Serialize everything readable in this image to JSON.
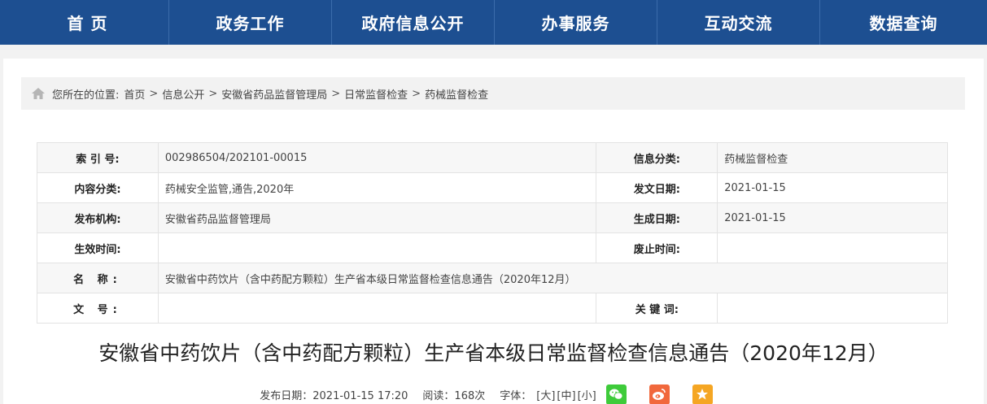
{
  "nav": {
    "items": [
      "首 页",
      "政务工作",
      "政府信息公开",
      "办事服务",
      "互动交流",
      "数据查询"
    ]
  },
  "breadcrumb": {
    "prefix": "您所在的位置:",
    "items": [
      "首页",
      "信息公开",
      "安徽省药品监督管理局",
      "日常监督检查",
      "药械监督检查"
    ],
    "separator": ">"
  },
  "meta": {
    "rows": [
      {
        "l1": "索 引 号:",
        "v1": "002986504/202101-00015",
        "l2": "信息分类:",
        "v2": "药械监督检查"
      },
      {
        "l1": "内容分类:",
        "v1": "药械安全监管,通告,2020年",
        "l2": "发文日期:",
        "v2": "2021-01-15"
      },
      {
        "l1": "发布机构:",
        "v1": "安徽省药品监督管理局",
        "l2": "生成日期:",
        "v2": "2021-01-15"
      },
      {
        "l1": "生效时间:",
        "v1": "",
        "l2": "废止时间:",
        "v2": ""
      },
      {
        "l1": "名 称:",
        "v1": "安徽省中药饮片（含中药配方颗粒）生产省本级日常监督检查信息通告（2020年12月）"
      },
      {
        "l1": "文 号:",
        "v1": "",
        "l2": "关 键 词:",
        "v2": ""
      }
    ]
  },
  "article": {
    "title": "安徽省中药饮片（含中药配方颗粒）生产省本级日常监督检查信息通告（2020年12月）",
    "publish": "发布日期：2021-01-15 17:20",
    "views": "阅读：168次",
    "font_label": "字体：",
    "font_large": "[大]",
    "font_mid": "[中]",
    "font_small": "[小]"
  },
  "colors": {
    "nav_bg": "#1d4f91",
    "wechat": "#3ecb3a",
    "weibo": "#f1683c",
    "favorite": "#f5a623"
  }
}
